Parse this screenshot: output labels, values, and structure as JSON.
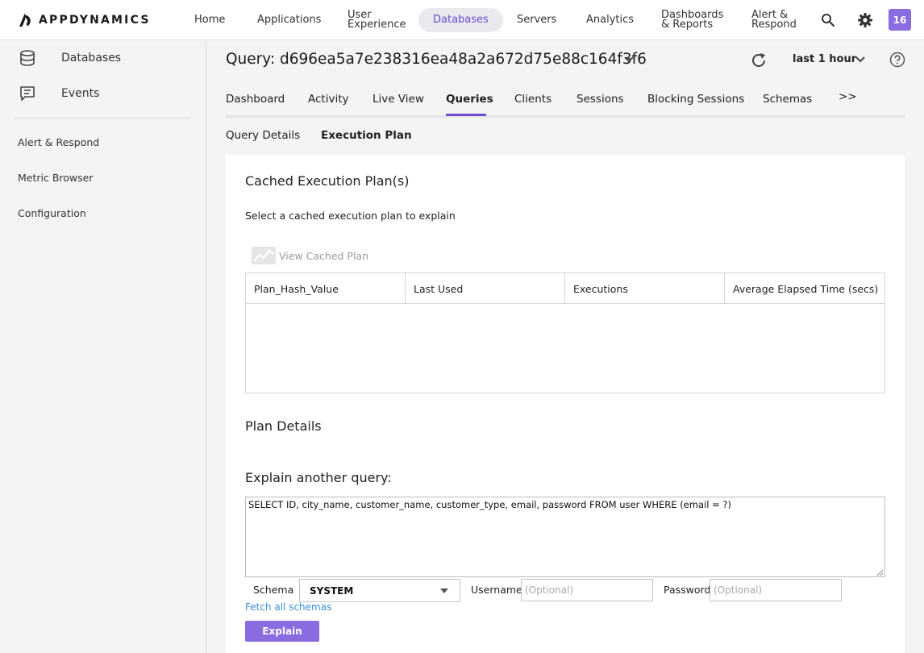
{
  "app": {
    "logo_text": "APPDYNAMICS",
    "brand_color": "#6c4fd6"
  },
  "nav": {
    "home": "Home",
    "applications": "Applications",
    "user_experience_1": "User",
    "user_experience_2": "Experience",
    "databases": "Databases",
    "servers": "Servers",
    "analytics": "Analytics",
    "dashboards_1": "Dashboards",
    "dashboards_2": "& Reports",
    "alert_1": "Alert &",
    "alert_2": "Respond",
    "badge": "16"
  },
  "sidebar": {
    "databases": "Databases",
    "events": "Events",
    "alert_respond": "Alert & Respond",
    "metric_browser": "Metric Browser",
    "configuration": "Configuration"
  },
  "header": {
    "query_title": "Query: d696ea5a7e238316ea48a2a672d75e88c164f3f6",
    "time_range": "last 1 hour"
  },
  "tabs": [
    "Dashboard",
    "Activity",
    "Live View",
    "Queries",
    "Clients",
    "Sessions",
    "Blocking Sessions",
    "Schemas",
    ">>"
  ],
  "subtabs": [
    "Query Details",
    "Execution Plan"
  ],
  "cached": {
    "title": "Cached Execution Plan(s)",
    "instruction": "Select a cached execution plan to explain",
    "view_button": "View Cached Plan",
    "columns": [
      "Plan_Hash_Value",
      "Last Used",
      "Executions",
      "Average Elapsed Time (secs)"
    ]
  },
  "plan_details": {
    "title": "Plan Details"
  },
  "explain": {
    "title": "Explain another query:",
    "query": "SELECT ID, city_name, customer_name, customer_type, email, password FROM user WHERE (email = ?)",
    "schema_label": "Schema",
    "schema_value": "SYSTEM",
    "username_label": "Username",
    "username_placeholder": "(Optional)",
    "password_label": "Password",
    "password_placeholder": "(Optional)",
    "fetch_link": "Fetch all schemas",
    "button": "Explain"
  }
}
